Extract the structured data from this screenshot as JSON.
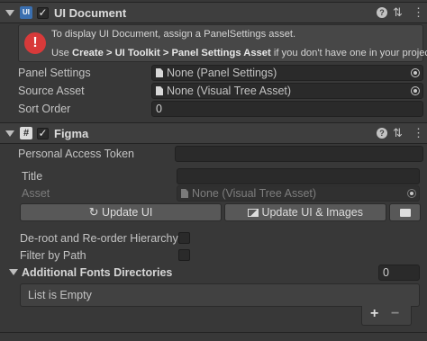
{
  "ui_document": {
    "title": "UI Document",
    "icon": "ui-document-icon",
    "enabled": true,
    "warning": {
      "line1": "To display UI Document, assign a PanelSettings asset.",
      "line2_prefix": "Use ",
      "line2_bold": "Create > UI Toolkit > Panel Settings Asset",
      "line2_suffix": " if you don't have one in your project."
    },
    "fields": {
      "panel_settings_label": "Panel Settings",
      "panel_settings_value": "None (Panel Settings)",
      "source_asset_label": "Source Asset",
      "source_asset_value": "None (Visual Tree Asset)",
      "sort_order_label": "Sort Order",
      "sort_order_value": "0"
    }
  },
  "figma": {
    "title": "Figma",
    "icon": "hash-script-icon",
    "enabled": true,
    "token_label": "Personal Access Token",
    "token_value": "",
    "title_label": "Title",
    "title_value": "",
    "asset_label": "Asset",
    "asset_value": "None (Visual Tree Asset)",
    "update_ui_label": "Update UI",
    "update_ui_images_label": "Update UI & Images",
    "deroot_label": "De-root and Re-order Hierarchy",
    "filter_label": "Filter by Path",
    "fonts_dirs_label": "Additional Fonts Directories",
    "fonts_dirs_count": "0",
    "list_empty_label": "List is Empty",
    "add_label": "+",
    "remove_label": "−"
  },
  "colors": {
    "background": "#383838",
    "header": "#3e3e3e",
    "field": "#2a2a2a",
    "button": "#585858",
    "error_red": "#d83a3a"
  }
}
